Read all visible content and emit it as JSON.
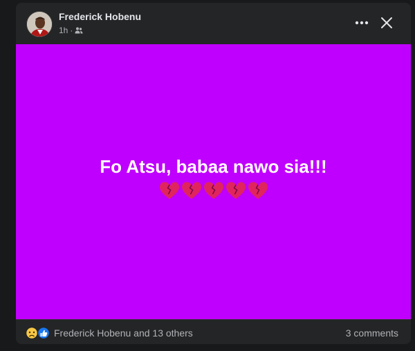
{
  "post": {
    "author": "Frederick Hobenu",
    "time": "1h",
    "separator": "·",
    "audience_icon": "friends-icon",
    "body_text": "Fo Atsu, babaa nawo sia!!!",
    "body_emoji_icon": "broken-heart-icon",
    "body_emoji_count": 5,
    "background_color": "#c000ff"
  },
  "header": {
    "more_icon": "more-options-icon",
    "close_icon": "close-icon"
  },
  "footer": {
    "reaction_icons": [
      "sad-reaction-icon",
      "like-reaction-icon"
    ],
    "reactions_text": "Frederick Hobenu and 13 others",
    "comments_text": "3 comments"
  }
}
